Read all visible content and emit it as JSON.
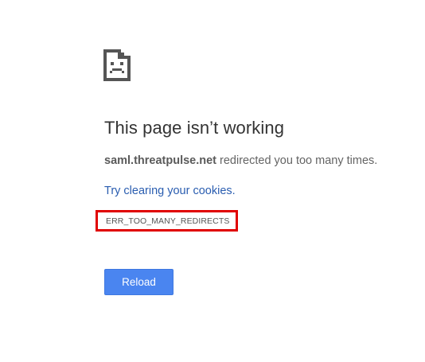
{
  "error_page": {
    "title": "This page isn’t working",
    "host": "saml.threatpulse.net",
    "message_suffix": " redirected you too many times.",
    "suggestion_link": "Try clearing your cookies.",
    "error_code": "ERR_TOO_MANY_REDIRECTS",
    "reload_label": "Reload"
  },
  "icons": {
    "status_icon": "sad-document-icon"
  },
  "colors": {
    "title": "#333333",
    "text": "#646464",
    "link": "#2a5db0",
    "highlight_border": "#e00000",
    "button_bg": "#4a85f0",
    "button_text": "#ffffff",
    "background": "#ffffff"
  }
}
